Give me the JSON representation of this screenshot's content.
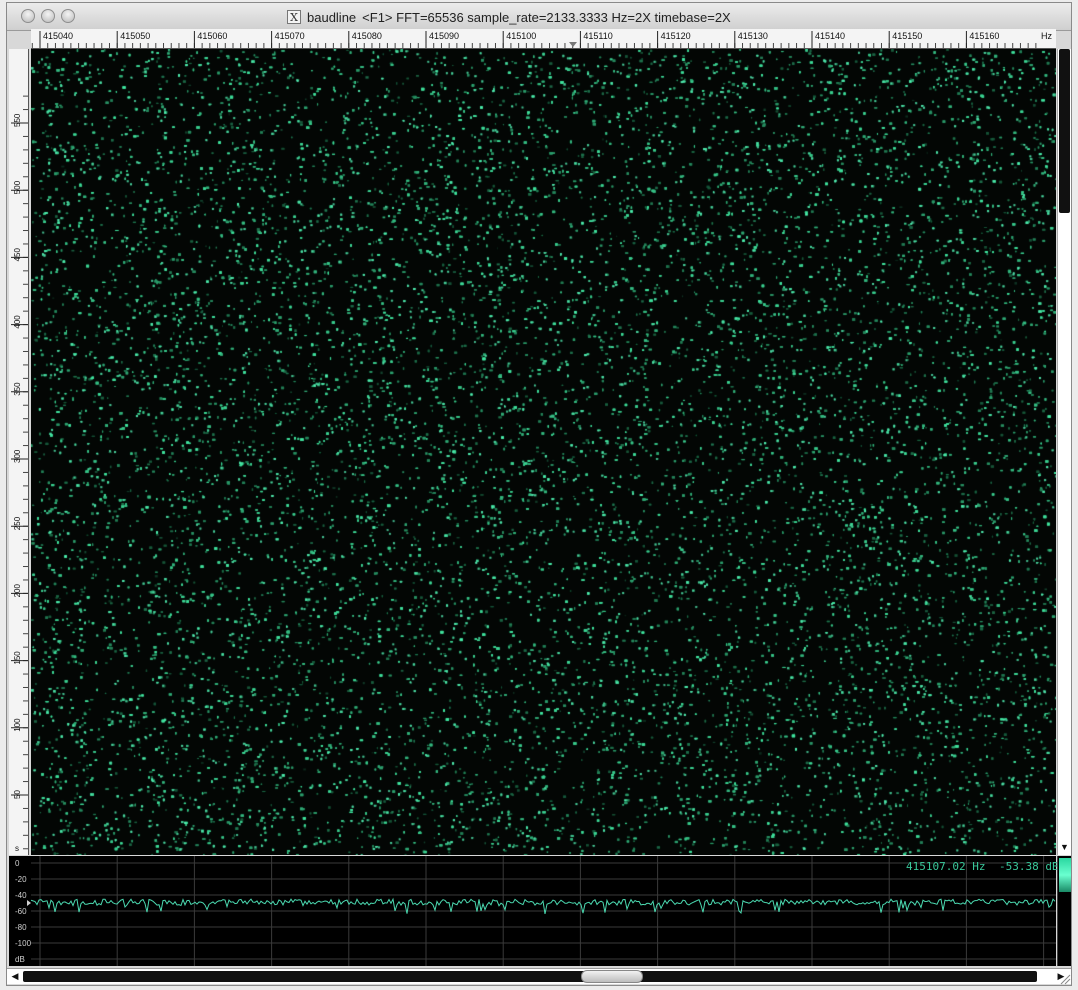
{
  "window": {
    "app_name": "baudline",
    "title_details": "<F1> FFT=65536 sample_rate=2133.3333 Hz=2X timebase=2X"
  },
  "freq_ruler": {
    "labels": [
      "415040",
      "415050",
      "415060",
      "415070",
      "415080",
      "415090",
      "415100",
      "415110",
      "415120",
      "415130",
      "415140",
      "415150",
      "415160"
    ],
    "unit": "Hz"
  },
  "time_ruler": {
    "labels": [
      "550",
      "500",
      "450",
      "400",
      "350",
      "300",
      "250",
      "200",
      "150",
      "100",
      "50"
    ],
    "unit": "s"
  },
  "spectrum": {
    "freq_readout": "415107.02 Hz",
    "db_readout": "-53.38 dB",
    "db_labels": [
      "0",
      "-20",
      "-40",
      "-60",
      "-80",
      "-100"
    ],
    "db_unit": "dB",
    "trace_level_db": -49
  },
  "colors": {
    "signal": "#3ddca8",
    "trace": "#4bd9b0",
    "background": "#000000",
    "grid": "#3a3a3a"
  }
}
